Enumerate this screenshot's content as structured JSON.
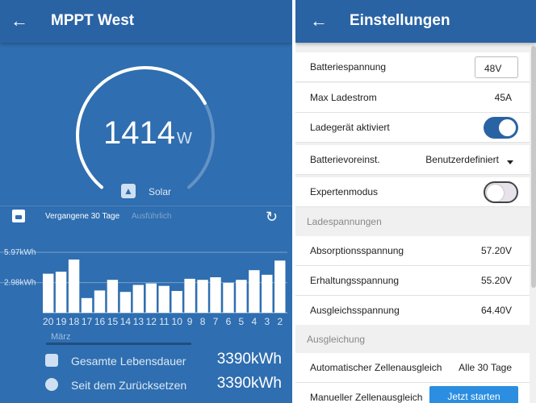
{
  "left": {
    "title": "MPPT West",
    "power": "1414",
    "power_unit": "W",
    "gauge_fraction": 0.72,
    "source_label": "Solar",
    "tab_period": "Vergangene 30 Tage",
    "tab_detail": "Ausführlich",
    "month_label": "März",
    "stats": [
      {
        "label": "Gesamte Lebensdauer",
        "value": "3390kWh"
      },
      {
        "label": "Seit dem Zurücksetzen",
        "value": "3390kWh"
      }
    ]
  },
  "chart_data": {
    "type": "bar",
    "categories": [
      "20",
      "19",
      "18",
      "17",
      "16",
      "15",
      "14",
      "13",
      "12",
      "11",
      "10",
      "9",
      "8",
      "7",
      "6",
      "5",
      "4",
      "3",
      "2"
    ],
    "values": [
      3.85,
      4.05,
      5.25,
      1.45,
      2.2,
      3.25,
      2.05,
      2.75,
      2.9,
      2.65,
      2.15,
      3.35,
      3.25,
      3.5,
      2.95,
      3.25,
      4.2,
      3.75,
      5.15
    ],
    "yticks": [
      "5.97kWh",
      "2.98kWh"
    ],
    "ytick_values": [
      5.97,
      2.98
    ],
    "ylim": [
      0,
      5.97
    ],
    "grid": true
  },
  "right": {
    "title": "Einstellungen",
    "battery_voltage_label": "Batteriespannung",
    "battery_voltage_value": "48V",
    "max_current_label": "Max Ladestrom",
    "max_current_value": "45A",
    "charger_enabled_label": "Ladegerät aktiviert",
    "charger_enabled": true,
    "battery_preset_label": "Batterievoreinst.",
    "battery_preset_value": "Benutzerdefiniert",
    "expert_mode_label": "Expertenmodus",
    "expert_mode": false,
    "section_charge_voltages": "Ladespannungen",
    "absorption_label": "Absorptionsspannung",
    "absorption_value": "57.20V",
    "float_label": "Erhaltungsspannung",
    "float_value": "55.20V",
    "equalization_label": "Ausgleichsspannung",
    "equalization_value": "64.40V",
    "section_equalization": "Ausgleichung",
    "auto_equalization_label": "Automatischer Zellenausgleich",
    "auto_equalization_value": "Alle 30 Tage",
    "manual_equalization_label": "Manueller Zellenausgleich",
    "manual_equalization_button": "Jetzt starten"
  },
  "icons": {
    "back": "arrow-left-icon",
    "save": "save-icon",
    "history": "history-icon",
    "solar": "solar-panel-icon"
  },
  "colors": {
    "header": "#2a63a4",
    "panel": "#2f6eb0",
    "accent_button": "#2b8ee0"
  }
}
